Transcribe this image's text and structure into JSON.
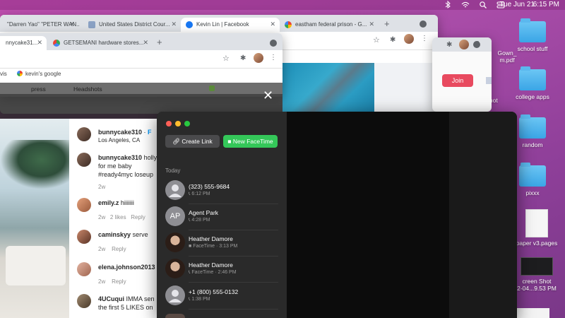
{
  "menubar": {
    "date": "Tue Jun 21",
    "time": "6:15 PM",
    "icons": [
      "bluetooth-icon",
      "wifi-icon",
      "search-icon",
      "control-center-icon"
    ]
  },
  "desktop": {
    "items": [
      {
        "label": "Gown_\nm.pdf"
      },
      {
        "label": "school stuff"
      },
      {
        "label": "Shot"
      },
      {
        "label": "college apps"
      },
      {
        "label": "random"
      },
      {
        "label": "pixxx"
      },
      {
        "label": "paper v3.pages"
      },
      {
        "label": "creen Shot\n2-04...9.53 PM"
      }
    ]
  },
  "back_browser": {
    "tabs": [
      {
        "label": "\"Darren Yao\" \"PETER WAN..."
      },
      {
        "label": "United States District Cour..."
      },
      {
        "label": "Kevin Lin | Facebook"
      },
      {
        "label": "eastham federal prison - G..."
      }
    ],
    "join_label": "Join"
  },
  "front_browser": {
    "tabs": [
      {
        "label": "nnycake31..."
      },
      {
        "label": "GETSEMANI hardware stores..."
      }
    ],
    "bookmarks": [
      "vis",
      "kevin's google"
    ],
    "ig_labels": [
      "press",
      "Headshots",
      ""
    ]
  },
  "instagram": {
    "post_user": "bunnycake310",
    "post_follow": "F",
    "post_location": "Los Angeles, CA",
    "comments": [
      {
        "user": "bunnycake310",
        "text": "holly",
        "text2": "for me baby",
        "text3": "#ready4myc loseup",
        "time": "2w"
      },
      {
        "user": "emily.z",
        "text": "hiiiiiii",
        "time": "2w",
        "likes": "2 likes",
        "reply": "Reply"
      },
      {
        "user": "caminskyy",
        "text": "serve",
        "time": "2w",
        "reply": "Reply"
      },
      {
        "user": "elena.johnson2013",
        "text": "",
        "time": "2w",
        "reply": "Reply"
      },
      {
        "user": "4UCuqui",
        "text": "IMMA sen",
        "text2": "the first 5 LIKES on"
      }
    ]
  },
  "facetime": {
    "create_link": "Create Link",
    "new_facetime": "New FaceTime",
    "section": "Today",
    "calls": [
      {
        "name": "(323) 555-9684",
        "time": "6:12 PM",
        "kind": "phone",
        "initials": ""
      },
      {
        "name": "Agent Park",
        "time": "4:28 PM",
        "kind": "phone",
        "initials": "AP"
      },
      {
        "name": "Heather Damore",
        "time": "FaceTime · 3:13 PM",
        "kind": "video",
        "initials": ""
      },
      {
        "name": "Heather Damore",
        "time": "FaceTime · 2:46 PM",
        "kind": "phone",
        "initials": ""
      },
      {
        "name": "+1 (800) 555-0132",
        "time": "1:38 PM",
        "kind": "phone",
        "initials": ""
      }
    ]
  },
  "colors": {
    "facetime_green": "#34c759",
    "ig_blue": "#0095f6",
    "join_red": "#e84a5f"
  }
}
